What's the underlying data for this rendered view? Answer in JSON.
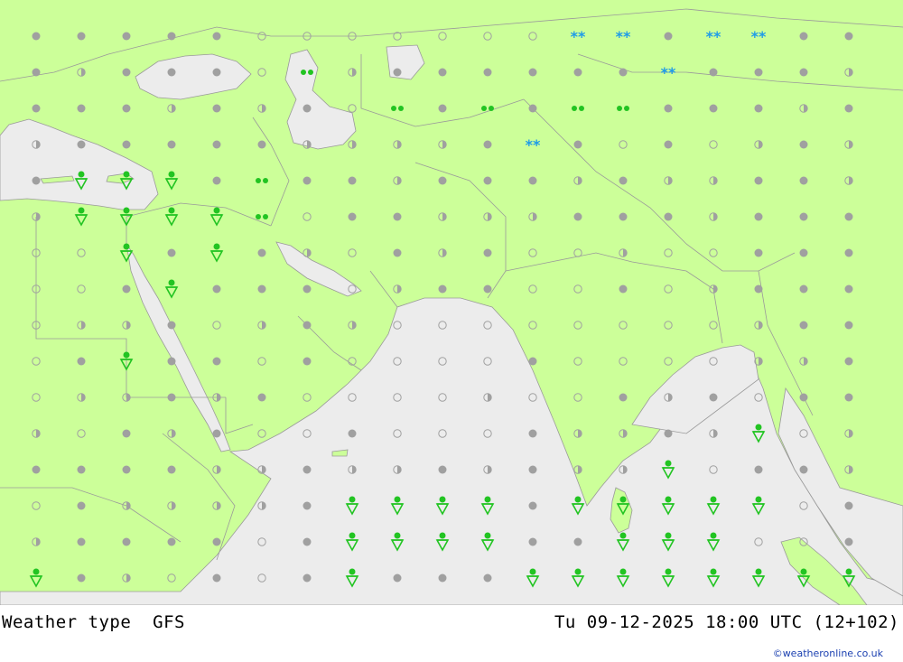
{
  "footer": {
    "product_label": "Weather type",
    "model_label": "GFS",
    "valid_time": "Tu 09-12-2025 18:00 UTC (12+102)",
    "credit": "©weatheronline.co.uk"
  },
  "colors": {
    "land": "#ccff99",
    "sea": "#ececec",
    "border": "#9a9a9a",
    "cloud": "#a0a0a0",
    "rain": "#22c422",
    "snow": "#1e9be8"
  },
  "legend_symbols": {
    "overcast": "filled grey dot",
    "partly_cloudy": "half-filled grey dot",
    "clear": "open grey circle",
    "showers": "green drop over down-triangle",
    "rain": "green dots",
    "snow": "blue asterisks"
  }
}
